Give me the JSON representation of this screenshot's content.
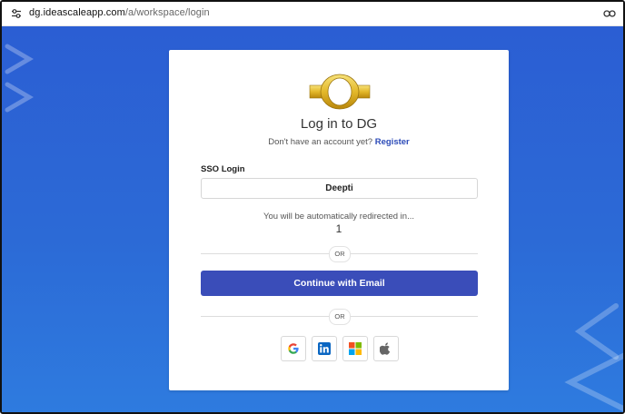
{
  "browser": {
    "url_domain": "dg.ideascaleapp.com",
    "url_path": "/a/workspace/login"
  },
  "login": {
    "title": "Log in to DG",
    "no_account_text": "Don't have an account yet?",
    "register_label": "Register",
    "sso_label": "SSO Login",
    "sso_value": "Deepti",
    "redirect_text": "You will be automatically redirected in...",
    "countdown": "1",
    "or_label_1": "OR",
    "continue_email_label": "Continue with Email",
    "or_label_2": "OR"
  },
  "social_buttons": [
    {
      "icon": "google-icon"
    },
    {
      "icon": "linkedin-icon"
    },
    {
      "icon": "microsoft-icon"
    },
    {
      "icon": "apple-icon"
    }
  ],
  "colors": {
    "background_top": "#2b5ed3",
    "background_bottom": "#2e7bdf",
    "primary_button": "#3a4db9",
    "link": "#2c4bb8"
  }
}
